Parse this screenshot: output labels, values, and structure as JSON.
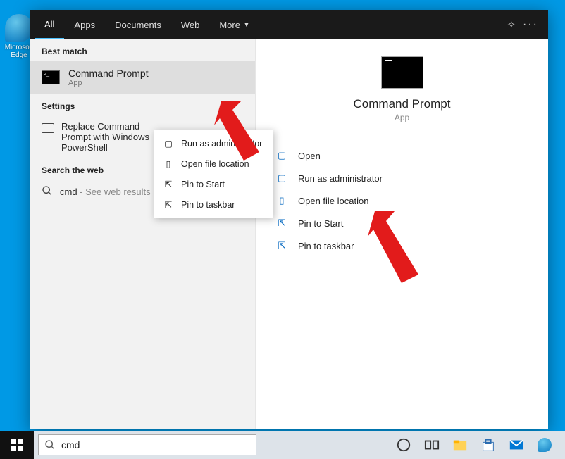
{
  "desktop": {
    "icon_label": "Microsoft Edge"
  },
  "tabs": {
    "items": [
      "All",
      "Apps",
      "Documents",
      "Web",
      "More"
    ],
    "active_index": 0
  },
  "left": {
    "best_match_label": "Best match",
    "result": {
      "title": "Command Prompt",
      "subtitle": "App"
    },
    "settings_label": "Settings",
    "settings_item": "Replace Command Prompt with Windows PowerShell",
    "search_web_label": "Search the web",
    "web_item": {
      "query": "cmd",
      "suffix": " - See web results"
    }
  },
  "context_menu": {
    "items": [
      {
        "icon": "admin",
        "label": "Run as administrator"
      },
      {
        "icon": "folder",
        "label": "Open file location"
      },
      {
        "icon": "pin",
        "label": "Pin to Start"
      },
      {
        "icon": "pin",
        "label": "Pin to taskbar"
      }
    ]
  },
  "preview": {
    "title": "Command Prompt",
    "subtitle": "App",
    "actions": [
      {
        "icon": "open",
        "label": "Open"
      },
      {
        "icon": "admin",
        "label": "Run as administrator"
      },
      {
        "icon": "folder",
        "label": "Open file location"
      },
      {
        "icon": "pin",
        "label": "Pin to Start"
      },
      {
        "icon": "pin",
        "label": "Pin to taskbar"
      }
    ]
  },
  "taskbar": {
    "search_value": "cmd"
  }
}
